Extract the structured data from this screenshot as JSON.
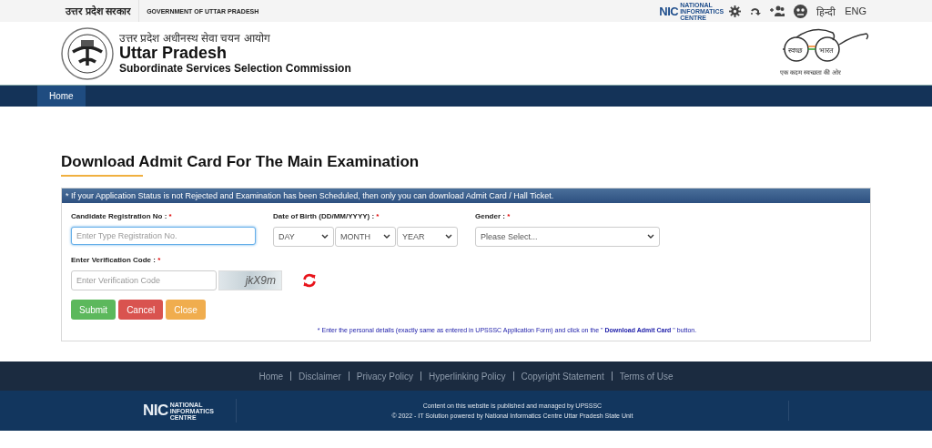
{
  "top_bar": {
    "hindi_title": "उत्तर प्रदेश सरकार",
    "english_title": "GOVERNMENT OF UTTAR PRADESH",
    "nic_logo": {
      "mark": "NIC",
      "text": "NATIONAL INFORMATICS CENTRE"
    },
    "languages": [
      "हिन्दी",
      "ENG"
    ]
  },
  "header": {
    "hindi_name": "उत्तर प्रदेश अधीनस्थ सेवा चयन आयोग",
    "name": "Uttar Pradesh",
    "subtitle": "Subordinate Services Selection Commission",
    "swachh_logo": {
      "left": "स्वच्छ",
      "right": "भारत",
      "tagline": "एक कदम स्वच्छता की ओर"
    }
  },
  "nav": [
    {
      "label": "Home",
      "selected": true
    }
  ],
  "page_title": "Download Admit Card For The Main Examination",
  "notice": "* If your Application Status is not Rejected and Examination has been Scheduled, then only you can download Admit Card / Hall Ticket.",
  "form": {
    "registration": {
      "label": "Candidate Registration No :",
      "required": "*",
      "placeholder": "Enter Type Registration No."
    },
    "dob": {
      "label": "Date of Birth (DD/MM/YYYY) :",
      "required": "*",
      "selects": [
        "DAY",
        "MONTH",
        "YEAR"
      ]
    },
    "gender": {
      "label": "Gender :",
      "required": "*",
      "value": "Please Select..."
    },
    "verification": {
      "label": "Enter Verification Code :",
      "required": "*",
      "placeholder": "Enter Verification Code",
      "captcha": "jkX9m"
    },
    "buttons": [
      {
        "label": "Submit",
        "kind": "success"
      },
      {
        "label": "Cancel",
        "kind": "danger"
      },
      {
        "label": "Close",
        "kind": "warning"
      }
    ],
    "note": "* Enter the personal details (exactly same as entered in UPSSSC Application Form) and click on the \" **Download Admit Card** \" button."
  },
  "footer": {
    "links": [
      "Home",
      "Disclaimer",
      "Privacy Policy",
      "Hyperlinking Policy",
      "Copyright Statement",
      "Terms of Use"
    ],
    "nic_logo": {
      "mark": "NIC",
      "text": "NATIONAL INFORMATICS CENTRE"
    },
    "lines": [
      "Content on this website is published and managed by UPSSSC",
      "© 2022 - IT Solution powered by National Informatics Centre Uttar Pradesh State Unit"
    ]
  }
}
